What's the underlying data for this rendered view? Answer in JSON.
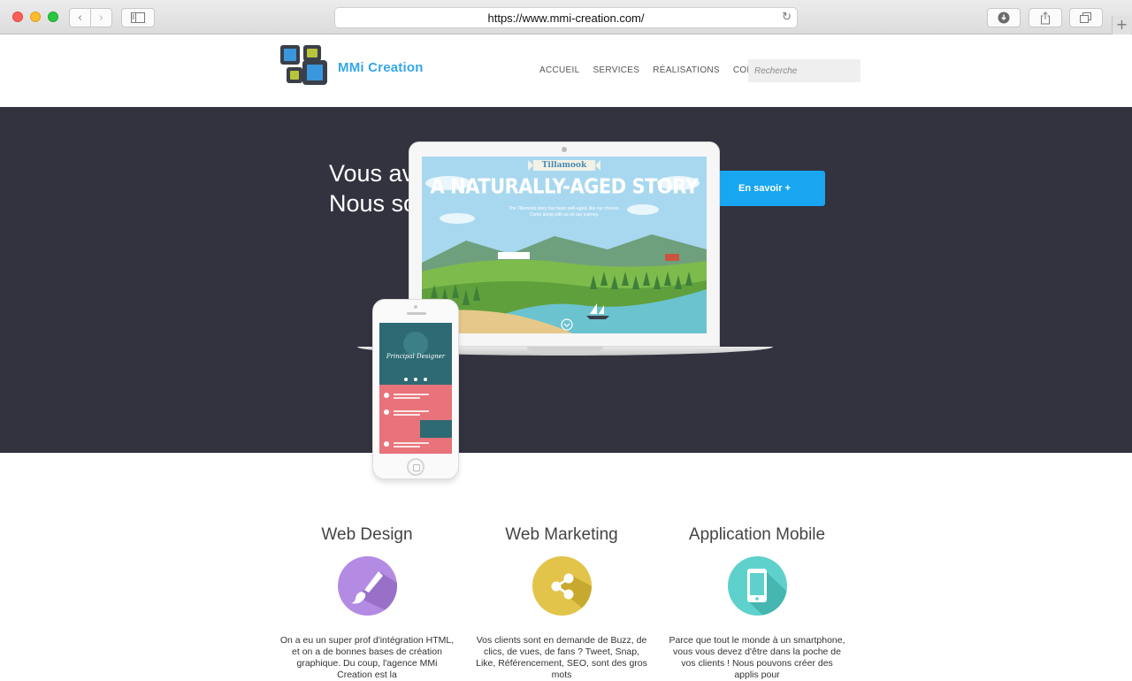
{
  "browser": {
    "url": "https://www.mmi-creation.com/"
  },
  "site": {
    "brand": "MMi Creation",
    "nav": [
      "ACCUEIL",
      "SERVICES",
      "RÉALISATIONS",
      "CONTACT"
    ],
    "search_placeholder": "Recherche"
  },
  "hero": {
    "title_line1": "Vous avez un besoin ?",
    "title_line2": "Nous sommes la solution !",
    "cta_label": "En savoir +",
    "laptop_screen": {
      "brand": "Tillamook",
      "headline": "A NATURALLY-AGED STORY",
      "sub1": "The Tillamook story has been well-aged, like our cheese.",
      "sub2": "Come along with us on our journey."
    },
    "phone_screen": {
      "title": "Principal Designer"
    }
  },
  "services": [
    {
      "title": "Web Design",
      "icon": "paintbrush-icon",
      "color": "#b48be3",
      "desc": "On a eu un super prof d'intégration HTML, et on a de bonnes bases de création graphique. Du coup, l'agence MMi Creation est la"
    },
    {
      "title": "Web Marketing",
      "icon": "share-icon",
      "color": "#e3c44a",
      "desc": "Vos clients sont en demande de Buzz, de clics, de vues, de fans ? Tweet, Snap, Like, Référencement, SEO, sont des gros mots"
    },
    {
      "title": "Application Mobile",
      "icon": "smartphone-icon",
      "color": "#5fd1cc",
      "desc": "Parce que tout le monde à un smartphone, vous vous devez d'être dans la poche de vos clients ! Nous pouvons créer des applis pour"
    }
  ]
}
